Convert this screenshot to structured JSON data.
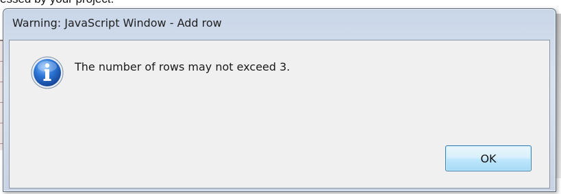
{
  "background": {
    "partial_text": "essed by your project."
  },
  "dialog": {
    "title": "Warning: JavaScript Window - Add row",
    "icon": "info-icon",
    "message": "The number of rows may not exceed 3.",
    "ok_label": "OK",
    "colors": {
      "titlebar": "#d2dcea",
      "client_bg": "#f0f0f0",
      "button_border": "#3c7fb1",
      "button_fill": "#bee6fd",
      "icon_blue": "#1f5fb4"
    }
  }
}
